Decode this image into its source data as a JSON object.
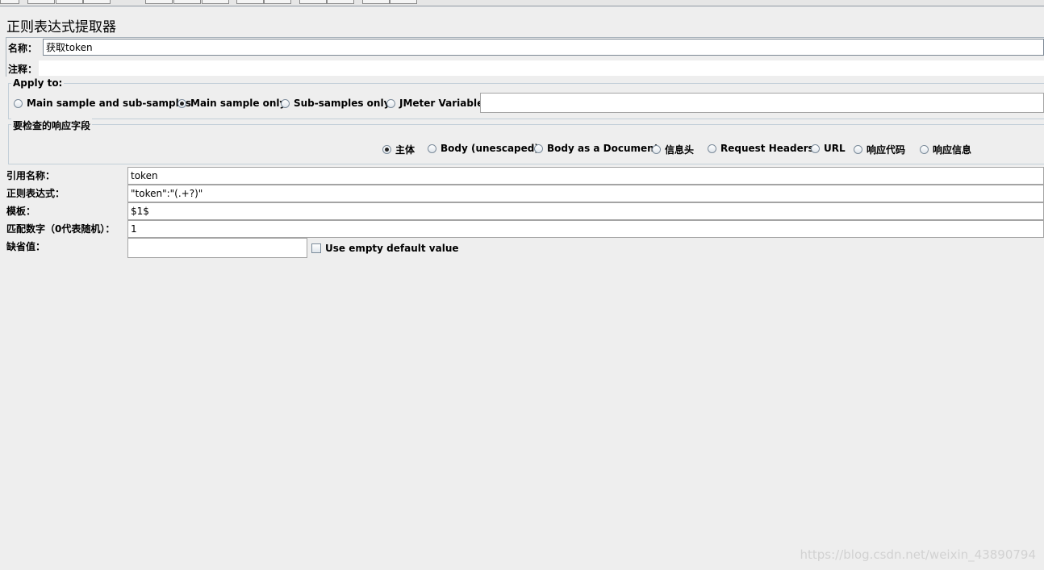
{
  "panel": {
    "title": "正则表达式提取器"
  },
  "name_row": {
    "label": "名称：",
    "value": "获取token"
  },
  "comment_row": {
    "label": "注释：",
    "value": ""
  },
  "apply_to": {
    "legend": "Apply to:",
    "options": [
      {
        "label": "Main sample and sub-samples",
        "checked": false
      },
      {
        "label": "Main sample only",
        "checked": true
      },
      {
        "label": "Sub-samples only",
        "checked": false
      },
      {
        "label": "JMeter Variable",
        "checked": false
      }
    ],
    "variable_value": ""
  },
  "field_to_check": {
    "legend": "要检查的响应字段",
    "options": [
      {
        "label": "主体",
        "checked": true
      },
      {
        "label": "Body (unescaped)",
        "checked": false
      },
      {
        "label": "Body as a Document",
        "checked": false
      },
      {
        "label": "信息头",
        "checked": false
      },
      {
        "label": "Request Headers",
        "checked": false
      },
      {
        "label": "URL",
        "checked": false
      },
      {
        "label": "响应代码",
        "checked": false
      },
      {
        "label": "响应信息",
        "checked": false
      }
    ]
  },
  "fields": {
    "ref_name": {
      "label": "引用名称：",
      "value": "token"
    },
    "regex": {
      "label": "正则表达式：",
      "value": "\"token\":\"(.+?)\""
    },
    "template": {
      "label": "模板：",
      "value": "$1$"
    },
    "match_no": {
      "label": "匹配数字（0代表随机）：",
      "value": "1"
    },
    "default": {
      "label": "缺省值：",
      "value": ""
    }
  },
  "use_empty_default": {
    "label": "Use empty default value",
    "checked": false
  },
  "watermark": "https://blog.csdn.net/weixin_43890794"
}
